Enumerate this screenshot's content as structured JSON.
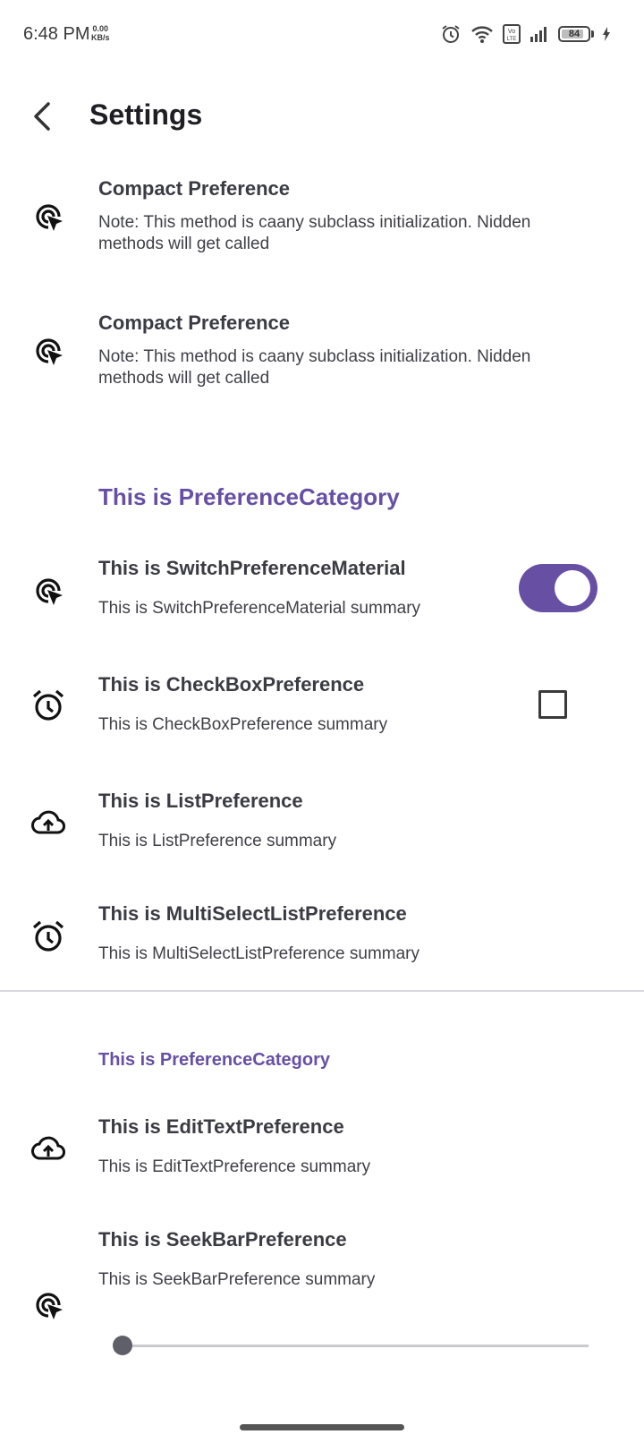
{
  "status_bar": {
    "time": "6:48 PM",
    "speed_value": "0.00",
    "speed_unit": "KB/s",
    "battery_level": "84",
    "battery_percent": 84,
    "icons": [
      "alarm-icon",
      "wifi-icon",
      "volte-icon",
      "signal-icon",
      "battery-icon",
      "charging-icon"
    ]
  },
  "app_bar": {
    "title": "Settings",
    "back_icon": "back-arrow-icon"
  },
  "colors": {
    "accent": "#6750a4",
    "text": "#3b3b44",
    "divider": "#d9d9dd"
  },
  "preferences": [
    {
      "title": "Compact Preference",
      "summary": "Note: This method is caany subclass initialization. Nidden methods will get called",
      "icon": "ads-click-icon"
    },
    {
      "title": "Compact Preference",
      "summary": "Note: This method is caany subclass initialization. Nidden methods will get called",
      "icon": "ads-click-icon"
    }
  ],
  "category_1": {
    "title": "This is PreferenceCategory",
    "items": [
      {
        "title": "This is SwitchPreferenceMaterial",
        "summary": "This is SwitchPreferenceMaterial summary",
        "icon": "ads-click-icon",
        "widget": "switch",
        "checked": true
      },
      {
        "title": "This is CheckBoxPreference",
        "summary": "This is CheckBoxPreference summary",
        "icon": "alarm-icon",
        "widget": "checkbox",
        "checked": false
      },
      {
        "title": "This is ListPreference",
        "summary": "This is ListPreference summary",
        "icon": "cloud-upload-icon"
      },
      {
        "title": "This is MultiSelectListPreference",
        "summary": "This is MultiSelectListPreference summary",
        "icon": "alarm-icon"
      }
    ]
  },
  "category_2": {
    "title": "This is PreferenceCategory",
    "items": [
      {
        "title": "This is EditTextPreference",
        "summary": "This is EditTextPreference summary",
        "icon": "cloud-upload-icon"
      },
      {
        "title": "This is SeekBarPreference",
        "summary": "This is SeekBarPreference summary",
        "icon": "ads-click-icon",
        "widget": "seekbar",
        "value_fraction": 0.0
      }
    ]
  }
}
